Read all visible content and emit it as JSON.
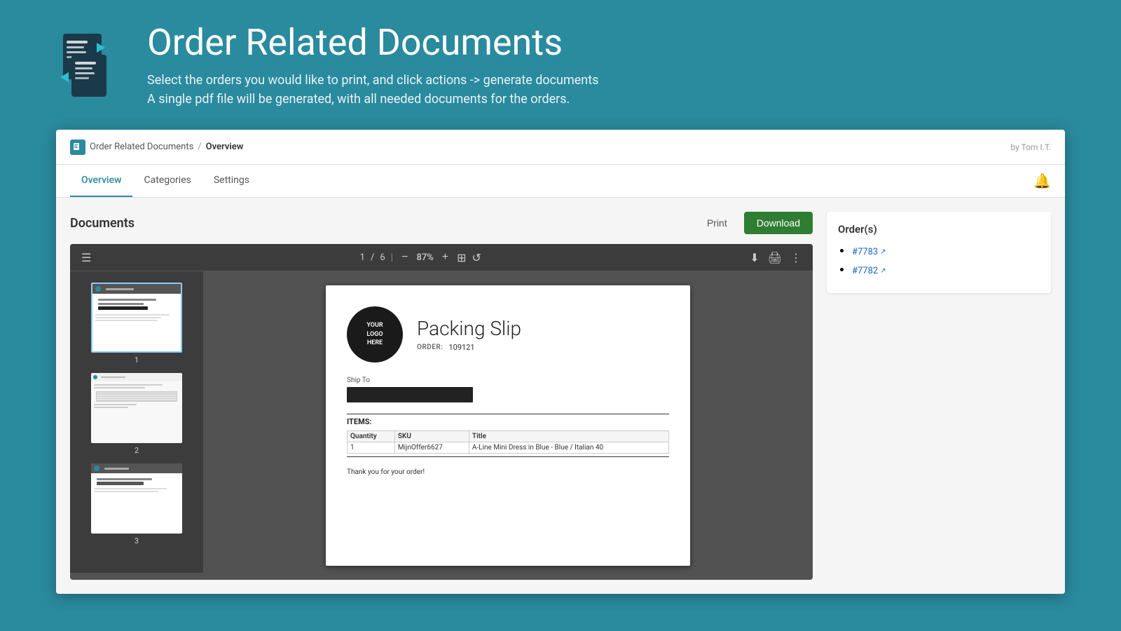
{
  "header": {
    "title": "Order Related Documents",
    "subtitle_line1": "Select the orders you would like to print, and click actions -> generate documents",
    "subtitle_line2": "A single pdf file will be generated, with all needed documents for the orders."
  },
  "breadcrumb": {
    "app_name": "Order Related Documents",
    "separator": "/",
    "current_page": "Overview"
  },
  "attribution": "by Tom I.T.",
  "tabs": [
    {
      "label": "Overview",
      "active": true
    },
    {
      "label": "Categories",
      "active": false
    },
    {
      "label": "Settings",
      "active": false
    }
  ],
  "documents_section": {
    "title": "Documents",
    "print_label": "Print",
    "download_label": "Download"
  },
  "pdf_toolbar": {
    "menu_icon": "☰",
    "page_current": "1",
    "page_separator": "/",
    "page_total": "6",
    "zoom_out": "−",
    "zoom_level": "87%",
    "zoom_in": "+",
    "more_icon": "⋮"
  },
  "pdf_thumbnails": [
    {
      "number": "1",
      "active": true
    },
    {
      "number": "2",
      "active": false
    },
    {
      "number": "3",
      "active": false
    }
  ],
  "packing_slip": {
    "logo_line1": "YOUR",
    "logo_line2": "LOGO",
    "logo_line3": "HERE",
    "title": "Packing Slip",
    "order_label": "ORDER:",
    "order_number": "109121",
    "ship_to_label": "Ship To",
    "items_label": "ITEMS:",
    "table_headers": [
      "Quantity",
      "SKU",
      "Title"
    ],
    "table_rows": [
      {
        "quantity": "1",
        "sku": "MijnOffer6627",
        "title": "A-Line Mini Dress in Blue - Blue / Italian 40"
      }
    ],
    "thank_you": "Thank you for your order!"
  },
  "orders_sidebar": {
    "title": "Order(s)",
    "orders": [
      {
        "id": "#7783",
        "url": "#"
      },
      {
        "id": "#7782",
        "url": "#"
      }
    ]
  }
}
